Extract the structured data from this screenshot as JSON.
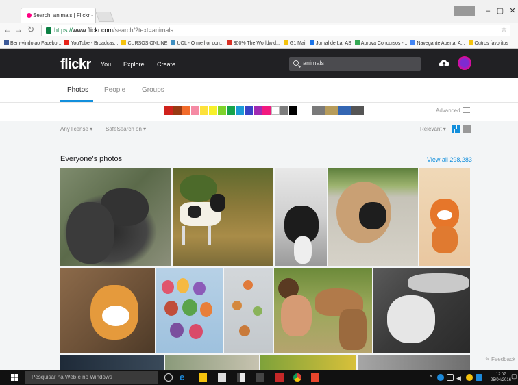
{
  "browser": {
    "tab_title": "Search: animals | Flickr - F",
    "url_scheme": "https://",
    "url_host": "www.flickr.com",
    "url_path": "/search/?text=animals",
    "bookmarks": [
      {
        "label": "Bem-vindo ao Facebo...",
        "color": "#3b5998"
      },
      {
        "label": "YouTube - Broadcas...",
        "color": "#e62117"
      },
      {
        "label": "CURSOS ONLINE",
        "color": "#f4c20d"
      },
      {
        "label": "UOL - O melhor con...",
        "color": "#3f8fc1"
      },
      {
        "label": "300% The Worldwid...",
        "color": "#d93025"
      },
      {
        "label": "G1 Mail",
        "color": "#f4c20d"
      },
      {
        "label": "Jornal de Lar AS",
        "color": "#1a73e8"
      },
      {
        "label": "Aprova Concursos -...",
        "color": "#34a853"
      },
      {
        "label": "Navegante Aberta, A...",
        "color": "#4285f4"
      },
      {
        "label": "Outros favoritos",
        "color": "#f4c20d"
      }
    ],
    "window_controls": {
      "minimize": "–",
      "maximize": "▢",
      "close": "✕"
    }
  },
  "flickr": {
    "logo": "flickr",
    "nav": [
      "You",
      "Explore",
      "Create"
    ],
    "search_value": "animals",
    "tabs": [
      "Photos",
      "People",
      "Groups"
    ],
    "color_swatches": [
      "#d0221c",
      "#993a13",
      "#f26c2b",
      "#f58aa4",
      "#fde13b",
      "#f7f02a",
      "#7ed32b",
      "#17a44b",
      "#1c9ad6",
      "#3944c6",
      "#a02ab2",
      "#f2197f",
      "#ffffff",
      "#7d7d7d",
      "#000000"
    ],
    "style_swatches": [
      "#7a7a7a",
      "#b79c5b",
      "#3466b3",
      "#555555"
    ],
    "advanced_label": "Advanced",
    "filters": {
      "license": "Any license",
      "safesearch": "SafeSearch on"
    },
    "sort": "Relevant",
    "section_title": "Everyone's photos",
    "view_all": "View all 298,283",
    "feedback": "Feedback"
  },
  "taskbar": {
    "search_placeholder": "Pesquisar na Web e no Windows",
    "time": "12:07",
    "date": "25/04/2016"
  }
}
